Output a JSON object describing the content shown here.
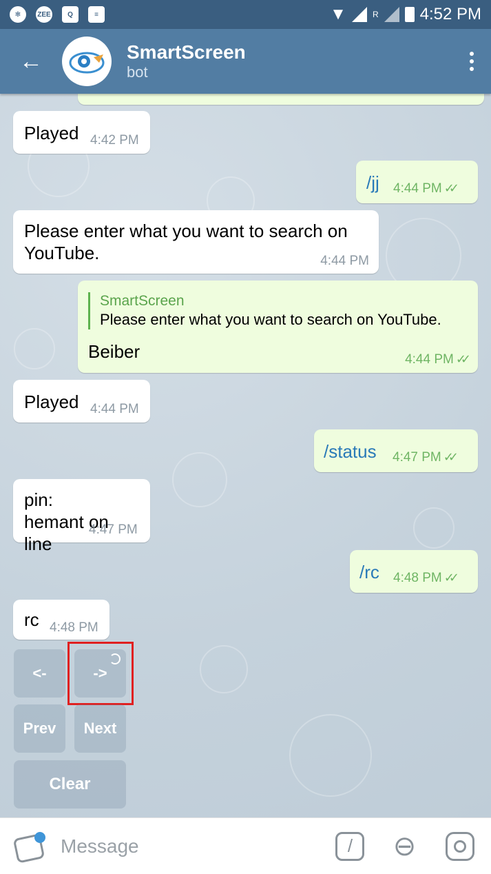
{
  "status_bar": {
    "left_icons": [
      "camera-aperture-icon",
      "zee-icon",
      "q-icon",
      "news-icon"
    ],
    "zee_label": "ZEE",
    "q_label": "Q",
    "roaming": "R",
    "time": "4:52 PM"
  },
  "header": {
    "title": "SmartScreen",
    "subtitle": "bot"
  },
  "messages": [
    {
      "dir": "in",
      "text": "Played",
      "time": "4:42 PM"
    },
    {
      "dir": "out",
      "text": "/jj",
      "time": "4:44 PM"
    },
    {
      "dir": "in",
      "text": "Please enter what you want to search on YouTube.",
      "time": "4:44 PM"
    },
    {
      "dir": "out",
      "reply_name": "SmartScreen",
      "reply_text": "Please enter what you want to search on YouTube.",
      "text": "Beiber",
      "time": "4:44 PM"
    },
    {
      "dir": "in",
      "text": "Played",
      "time": "4:44 PM"
    },
    {
      "dir": "out",
      "text": "/status",
      "time": "4:47 PM"
    },
    {
      "dir": "in",
      "text": "pin: hemant on line",
      "time": "4:47 PM"
    },
    {
      "dir": "out",
      "text": "/rc",
      "time": "4:48 PM"
    },
    {
      "dir": "in",
      "text": "rc",
      "time": "4:48 PM"
    }
  ],
  "keyboard": {
    "prev_arrow": "<-",
    "next_arrow": "->",
    "prev": "Prev",
    "next": "Next",
    "clear": "Clear"
  },
  "input": {
    "placeholder": "Message"
  },
  "colors": {
    "header": "#527da3",
    "status_bar": "#3a5e80",
    "outgoing_bubble": "#effdde",
    "highlight": "#e02020"
  }
}
